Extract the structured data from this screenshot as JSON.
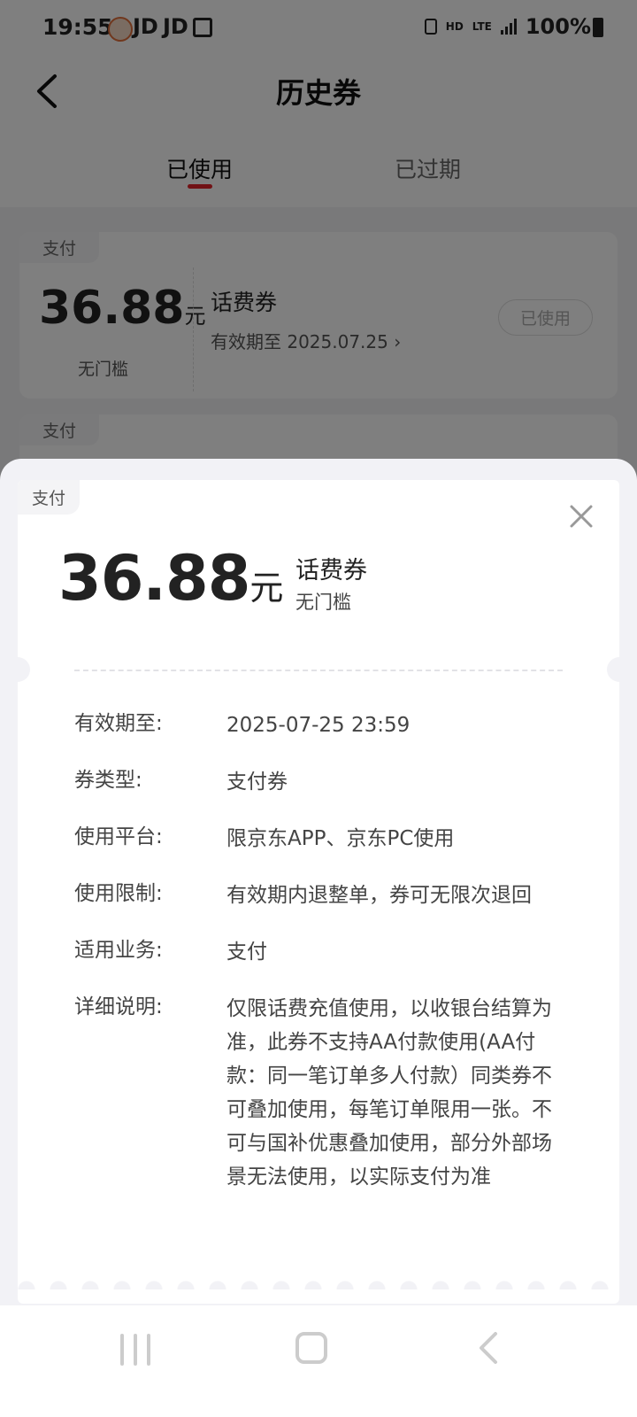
{
  "status_bar": {
    "time": "19:55",
    "jd1": "JD",
    "jd2": "JD",
    "hd": "HD",
    "lte": "LTE",
    "battery": "100%"
  },
  "header": {
    "title": "历史券"
  },
  "tabs": [
    {
      "label": "已使用",
      "active": true
    },
    {
      "label": "已过期",
      "active": false
    }
  ],
  "list_cards": [
    {
      "tag": "支付",
      "amount": "36.88",
      "unit": "元",
      "threshold": "无门槛",
      "name": "话费券",
      "validity": "有效期至 2025.07.25 ›",
      "status": "已使用"
    },
    {
      "tag": "支付"
    }
  ],
  "detail": {
    "tag": "支付",
    "amount": "36.88",
    "unit": "元",
    "name": "话费券",
    "threshold": "无门槛",
    "rows": [
      {
        "label": "有效期至:",
        "value": "2025-07-25 23:59"
      },
      {
        "label": "券类型:",
        "value": "支付券"
      },
      {
        "label": "使用平台:",
        "value": "限京东APP、京东PC使用"
      },
      {
        "label": "使用限制:",
        "value": "有效期内退整单，券可无限次退回"
      },
      {
        "label": "适用业务:",
        "value": "支付"
      },
      {
        "label": "详细说明:",
        "value": "仅限话费充值使用，以收银台结算为准，此券不支持AA付款使用(AA付款：同一笔订单多人付款）同类券不可叠加使用，每笔订单限用一张。不可与国补优惠叠加使用，部分外部场景无法使用，以实际支付为准"
      }
    ]
  },
  "colors": {
    "accent": "#e3242b",
    "overlay": "rgba(0,0,0,0.5)"
  }
}
